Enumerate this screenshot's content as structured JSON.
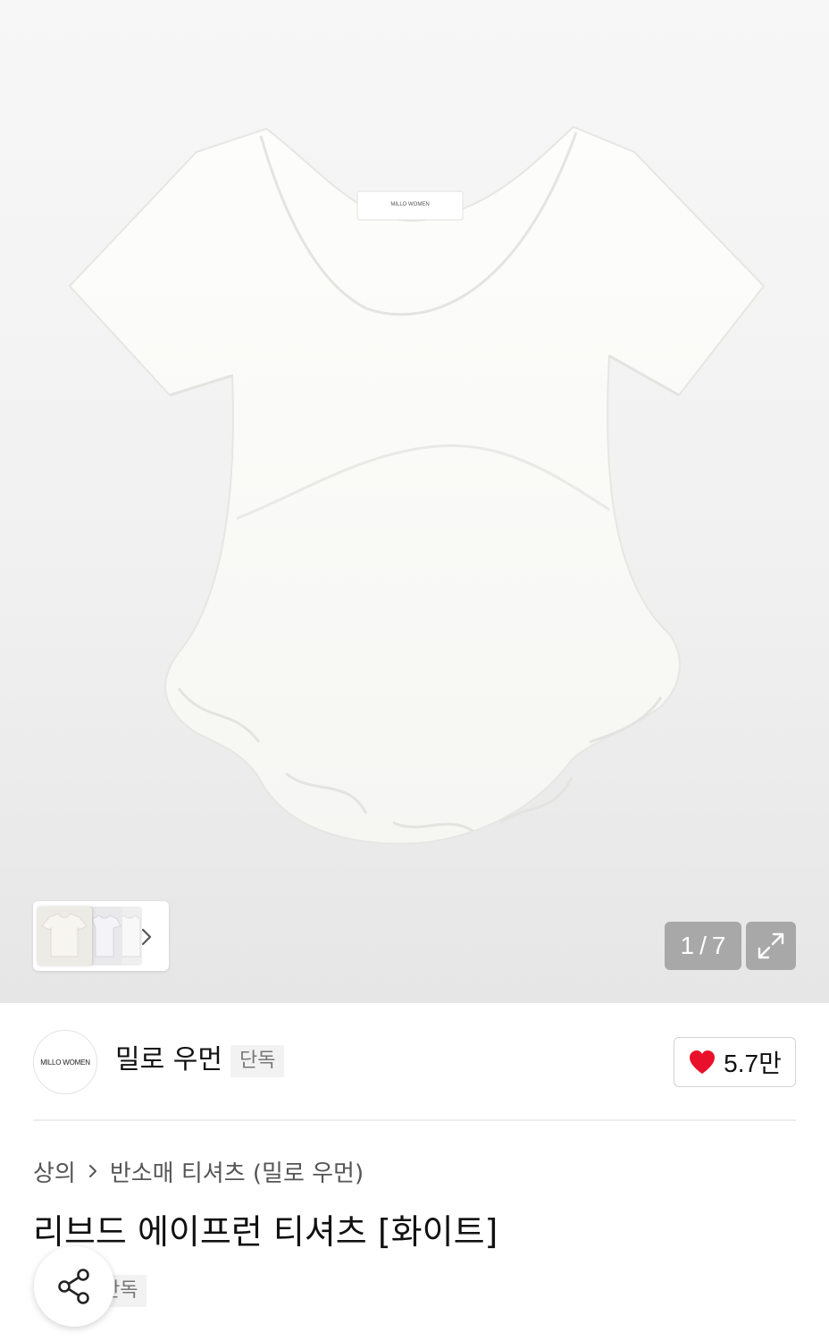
{
  "gallery": {
    "product_label_text": "MILLO WOMEN",
    "counter": {
      "current": "1",
      "separator": "/",
      "total": "7"
    },
    "expand_icon": "expand-icon",
    "thumbnails_next_icon": "chevron-right-icon"
  },
  "brand": {
    "logo_text": "MILLO WOMEN",
    "name": "밀로 우먼",
    "tag": "단독",
    "likes": "5.7만",
    "like_icon": "heart-icon",
    "like_color": "#e8102b"
  },
  "breadcrumb": {
    "category": "상의",
    "subcategory": "반소매 티셔츠 (밀로 우먼)"
  },
  "product": {
    "title": "리브드 에이프런 티셔츠 [화이트]",
    "tag": "단독"
  },
  "share": {
    "icon": "share-icon"
  }
}
